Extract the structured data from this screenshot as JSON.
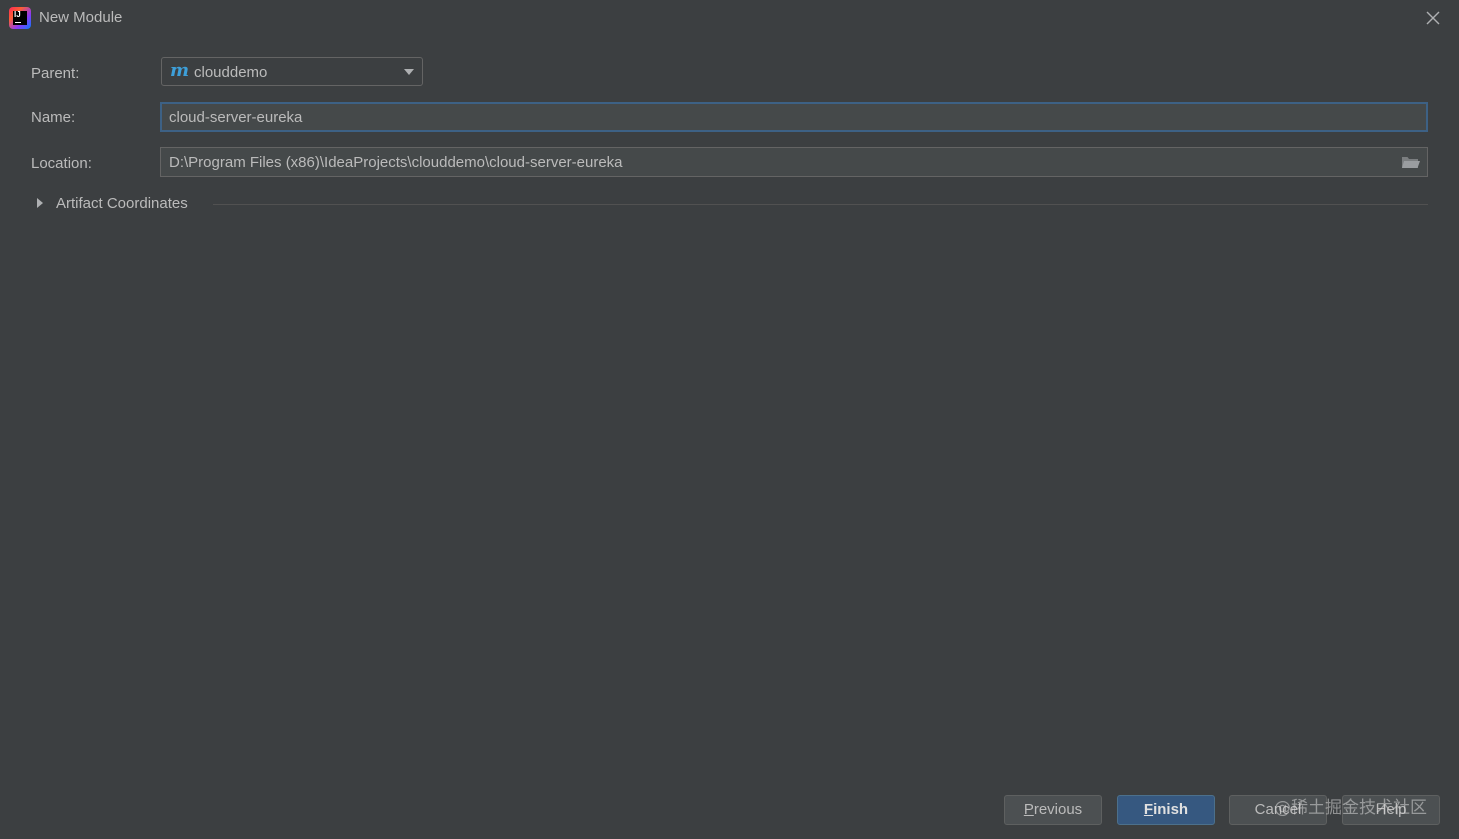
{
  "window": {
    "title": "New Module",
    "icon": "intellij-idea-icon",
    "icon_text": "IJ"
  },
  "form": {
    "parent": {
      "label": "Parent:",
      "value": "clouddemo",
      "icon": "maven-module-icon",
      "icon_glyph": "m"
    },
    "name": {
      "label": "Name:",
      "value": "cloud-server-eureka"
    },
    "location": {
      "label": "Location:",
      "value": "D:\\Program Files (x86)\\IdeaProjects\\clouddemo\\cloud-server-eureka",
      "browse_icon": "folder-open-icon"
    }
  },
  "sections": {
    "artifact_coordinates": {
      "label": "Artifact Coordinates",
      "expanded": false
    }
  },
  "buttons": {
    "previous": {
      "mnemonic": "P",
      "rest": "revious"
    },
    "finish": {
      "mnemonic": "F",
      "rest": "inish"
    },
    "cancel": {
      "label": "Cancel"
    },
    "help": {
      "label": "Help"
    }
  },
  "watermark": "@稀土掘金技术社区",
  "colors": {
    "background": "#3c3f41",
    "input_background": "#45494a",
    "focus_border": "#3d6185",
    "primary_button": "#365880",
    "maven_icon": "#3d9fd9",
    "text": "#bbbbbb"
  }
}
